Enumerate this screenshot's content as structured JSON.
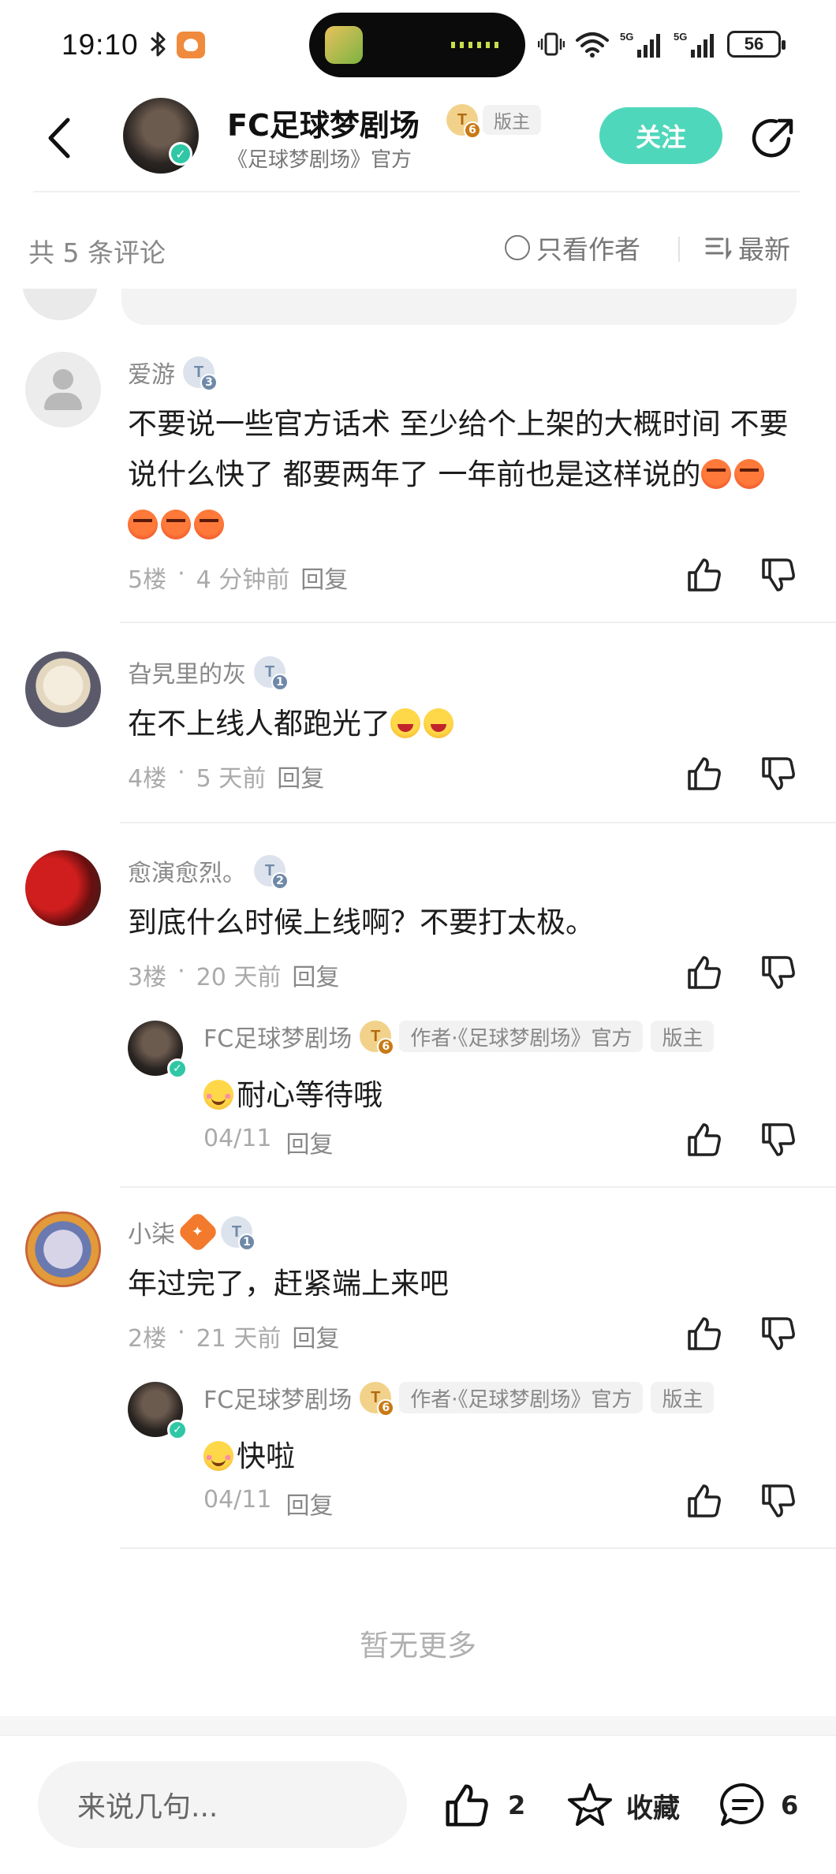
{
  "status_bar": {
    "time": "19:10",
    "battery": "56",
    "network": "5G"
  },
  "header": {
    "title": "FC足球梦剧场",
    "level": "6",
    "role_badge": "版主",
    "subtitle": "《足球梦剧场》官方",
    "follow_label": "关注"
  },
  "bar": {
    "count_label": "共 5 条评论",
    "author_only_label": "只看作者",
    "sort_label": "最新"
  },
  "comments": [
    {
      "user": "爱游",
      "level": "3",
      "text": "不要说一些官方话术  至少给个上架的大概时间 不要说什么快了   都要两年了  一年前也是这样说的",
      "emoji_count": 5,
      "floor": "5楼",
      "time": "4 分钟前",
      "reply_label": "回复"
    },
    {
      "user": "旮旯里的灰",
      "level": "1",
      "text": "在不上线人都跑光了",
      "floor": "4楼",
      "time": "5 天前",
      "reply_label": "回复"
    },
    {
      "user": "愈演愈烈。",
      "level": "2",
      "text": "到底什么时候上线啊？不要打太极。",
      "floor": "3楼",
      "time": "20 天前",
      "reply_label": "回复",
      "reply": {
        "user": "FC足球梦剧场",
        "level": "6",
        "tag_author": "作者·《足球梦剧场》官方",
        "tag_role": "版主",
        "text": "耐心等待哦",
        "time": "04/11",
        "reply_label": "回复"
      }
    },
    {
      "user": "小柒",
      "level": "1",
      "text": "年过完了，赶紧端上来吧",
      "floor": "2楼",
      "time": "21 天前",
      "reply_label": "回复",
      "reply": {
        "user": "FC足球梦剧场",
        "level": "6",
        "tag_author": "作者·《足球梦剧场》官方",
        "tag_role": "版主",
        "text": "快啦",
        "time": "04/11",
        "reply_label": "回复"
      }
    }
  ],
  "dot": "·",
  "level_prefix": "T",
  "end_label": "暂无更多",
  "bottom": {
    "input_placeholder": "来说几句...",
    "like_count": "2",
    "favorite_label": "收藏",
    "comment_count": "6"
  },
  "colors": {
    "accent": "#4fd7bb",
    "verify": "#2fc7a5",
    "level_badge": "#6f89a8",
    "level_badge_gold": "#c97a15"
  }
}
